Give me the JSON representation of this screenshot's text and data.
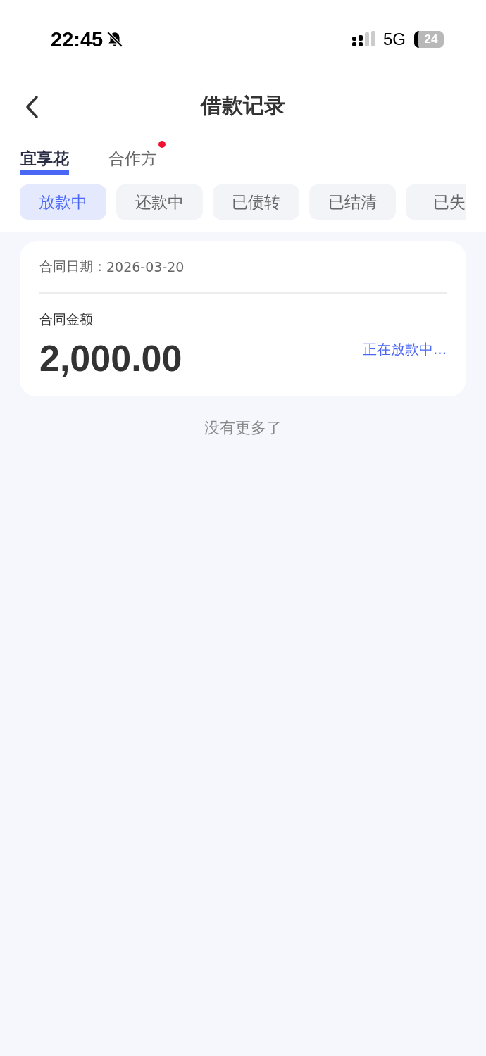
{
  "status_bar": {
    "time": "22:45",
    "network": "5G",
    "battery": "24",
    "muted": true
  },
  "header": {
    "title": "借款记录"
  },
  "tabs": [
    {
      "label": "宜享花",
      "selected": true,
      "badge": false
    },
    {
      "label": "合作方",
      "selected": false,
      "badge": true
    }
  ],
  "filters": [
    {
      "label": "放款中",
      "selected": true
    },
    {
      "label": "还款中",
      "selected": false
    },
    {
      "label": "已债转",
      "selected": false
    },
    {
      "label": "已结清",
      "selected": false
    },
    {
      "label": "已失",
      "selected": false
    }
  ],
  "records": [
    {
      "date_label": "合同日期：",
      "date": "2026-03-20",
      "amount_label": "合同金额",
      "amount": "2,000.00",
      "status": "正在放款中..."
    }
  ],
  "footer": "没有更多了"
}
